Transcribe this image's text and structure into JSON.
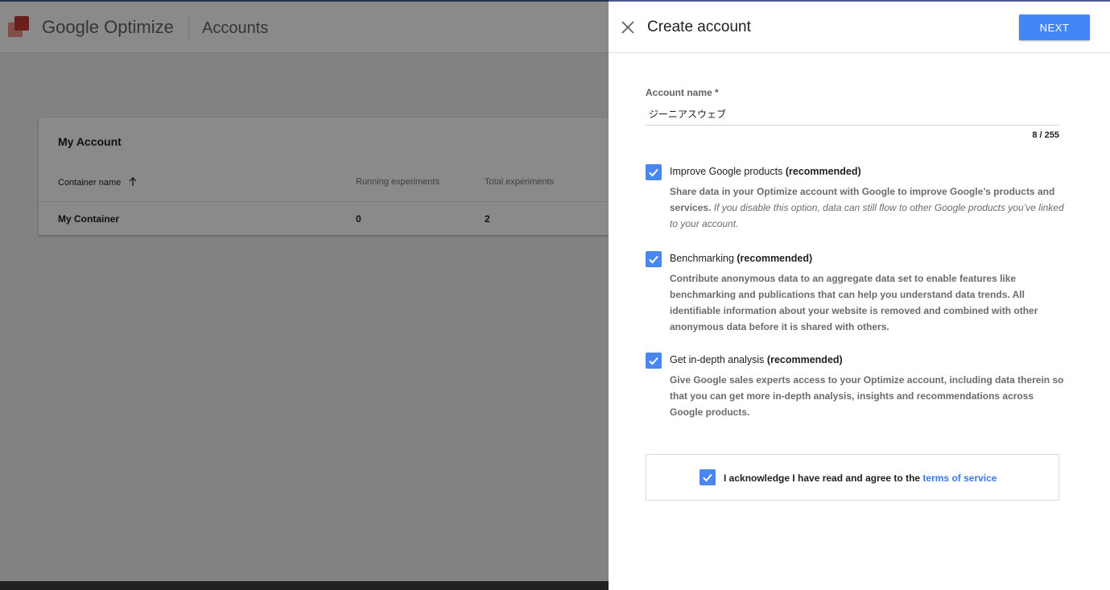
{
  "app": {
    "brand_google": "Google",
    "brand_product": "Optimize",
    "breadcrumb": "Accounts"
  },
  "account_card": {
    "title": "My Account",
    "columns": [
      "Container name",
      "Running experiments",
      "Total experiments"
    ],
    "rows": [
      {
        "name": "My Container",
        "running": "0",
        "total": "2"
      }
    ]
  },
  "panel": {
    "title": "Create account",
    "next_label": "NEXT",
    "account_name_label": "Account name *",
    "account_name_value": "ジーニアスウェブ",
    "char_counter": "8 / 255",
    "options": [
      {
        "title": "Improve Google products",
        "tag": "(recommended)",
        "desc_bold": "Share data in your Optimize account with Google to improve Google’s products and services.",
        "desc_italic": "If you disable this option, data can still flow to other Google products you’ve linked to your account.",
        "checked": true
      },
      {
        "title": "Benchmarking",
        "tag": "(recommended)",
        "desc_bold": "Contribute anonymous data to an aggregate data set to enable features like benchmarking and publications that can help you understand data trends. All identifiable information about your website is removed and combined with other anonymous data before it is shared with others.",
        "desc_italic": "",
        "checked": true
      },
      {
        "title": "Get in-depth analysis",
        "tag": "(recommended)",
        "desc_bold": "Give Google sales experts access to your Optimize account, including data therein so that you can get more in-depth analysis, insights and recommendations across Google products.",
        "desc_italic": "",
        "checked": true
      }
    ],
    "acknowledge_text": "I acknowledge I have read and agree to the",
    "terms_link": "terms of service",
    "acknowledge_checked": true
  },
  "colors": {
    "primary": "#4285f4",
    "checkbox": "#4a86f0",
    "link": "#3b78e7",
    "logo_dark": "#c63a33",
    "logo_light": "#f08c84"
  }
}
